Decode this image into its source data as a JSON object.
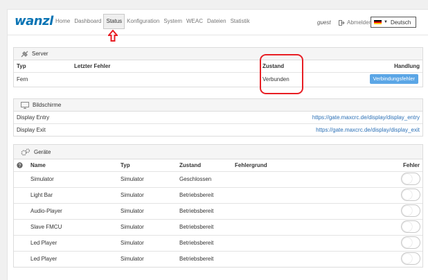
{
  "header": {
    "logo": "wanzl",
    "nav": [
      "Home",
      "Dashboard",
      "Status",
      "Konfiguration",
      "System",
      "WEAC",
      "Dateien",
      "Statistik"
    ],
    "active_nav": "Status",
    "user": "guest",
    "logout": "Abmelden",
    "language": "Deutsch"
  },
  "server": {
    "title": "Server",
    "columns": [
      "Typ",
      "Letzter Fehler",
      "Zustand",
      "Handlung"
    ],
    "rows": [
      {
        "typ": "Fern",
        "fehler": "",
        "zustand": "Verbunden",
        "action": "Verbindungsfehler"
      }
    ]
  },
  "screens": {
    "title": "Bildschirme",
    "rows": [
      {
        "name": "Display Entry",
        "url": "https://gate.maxcrc.de/display/display_entry"
      },
      {
        "name": "Display Exit",
        "url": "https://gate.maxcrc.de/display/display_exit"
      }
    ]
  },
  "devices": {
    "title": "Geräte",
    "columns": [
      "Name",
      "Typ",
      "Zustand",
      "Fehlergrund",
      "Fehler"
    ],
    "rows": [
      {
        "name": "Simulator",
        "typ": "Simulator",
        "zustand": "Geschlossen",
        "grund": "",
        "fehler": false
      },
      {
        "name": "Light Bar",
        "typ": "Simulator",
        "zustand": "Betriebsbereit",
        "grund": "",
        "fehler": false
      },
      {
        "name": "Audio-Player",
        "typ": "Simulator",
        "zustand": "Betriebsbereit",
        "grund": "",
        "fehler": false
      },
      {
        "name": "Slave FMCU",
        "typ": "Simulator",
        "zustand": "Betriebsbereit",
        "grund": "",
        "fehler": false
      },
      {
        "name": "Led Player",
        "typ": "Simulator",
        "zustand": "Betriebsbereit",
        "grund": "",
        "fehler": false
      },
      {
        "name": "Led Player",
        "typ": "Simulator",
        "zustand": "Betriebsbereit",
        "grund": "",
        "fehler": false
      }
    ]
  },
  "colors": {
    "accent": "#5ba6e6",
    "logo": "#0a74b4",
    "annotation": "#e81e24"
  }
}
